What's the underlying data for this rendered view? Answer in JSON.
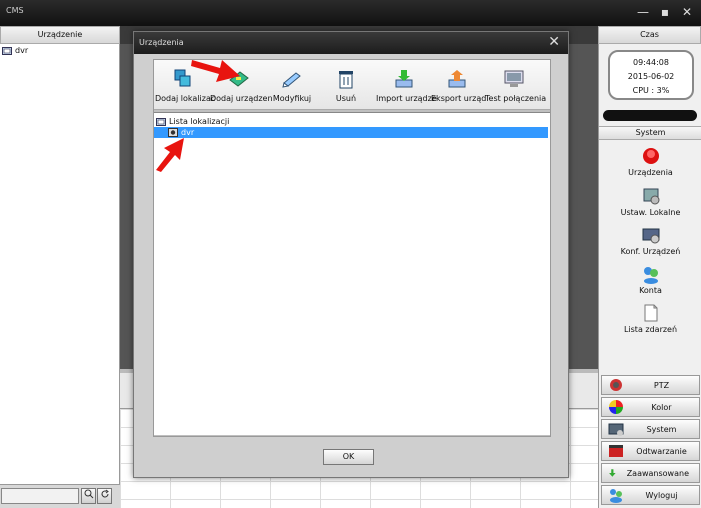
{
  "app": {
    "title": "CMS"
  },
  "window_controls": {
    "minimize": "—",
    "maximize": "▪",
    "close": "✕"
  },
  "left": {
    "header": "Urządzenie",
    "tree": [
      {
        "label": "dvr"
      }
    ]
  },
  "right": {
    "header": "Czas",
    "clock": {
      "time": "09:44:08",
      "date": "2015-06-02",
      "cpu": "CPU : 3%"
    },
    "system_header": "System",
    "items": [
      {
        "label": "Urządzenia",
        "icon": "record-button-icon"
      },
      {
        "label": "Ustaw. Lokalne",
        "icon": "local-settings-icon"
      },
      {
        "label": "Konf. Urządzeń",
        "icon": "device-config-icon"
      },
      {
        "label": "Konta",
        "icon": "users-icon"
      },
      {
        "label": "Lista zdarzeń",
        "icon": "document-icon"
      }
    ],
    "bottom_buttons": [
      {
        "label": "PTZ",
        "icon": "ptz-icon"
      },
      {
        "label": "Kolor",
        "icon": "color-wheel-icon"
      },
      {
        "label": "System",
        "icon": "system-icon"
      },
      {
        "label": "Odtwarzanie",
        "icon": "film-icon"
      },
      {
        "label": "Zaawansowane",
        "icon": "down-arrow-icon"
      },
      {
        "label": "Wyloguj",
        "icon": "users-icon"
      }
    ]
  },
  "dialog": {
    "title": "Urządzenia",
    "toolbar": [
      {
        "label": "Dodaj lokalizac",
        "icon": "add-location-icon"
      },
      {
        "label": "Dodaj urządzen",
        "icon": "add-device-icon"
      },
      {
        "label": "Modyfikuj",
        "icon": "modify-icon"
      },
      {
        "label": "Usuń",
        "icon": "trash-icon"
      },
      {
        "label": "Import urządze",
        "icon": "import-icon"
      },
      {
        "label": "Eksport urząd",
        "icon": "export-icon"
      },
      {
        "label": "Test połączenia",
        "icon": "connection-test-icon"
      }
    ],
    "tree": {
      "root": "Lista lokalizacji",
      "child": "dvr"
    },
    "ok_label": "OK"
  },
  "colors": {
    "selection": "#3399ff",
    "annotation_arrow": "#e8140f"
  }
}
